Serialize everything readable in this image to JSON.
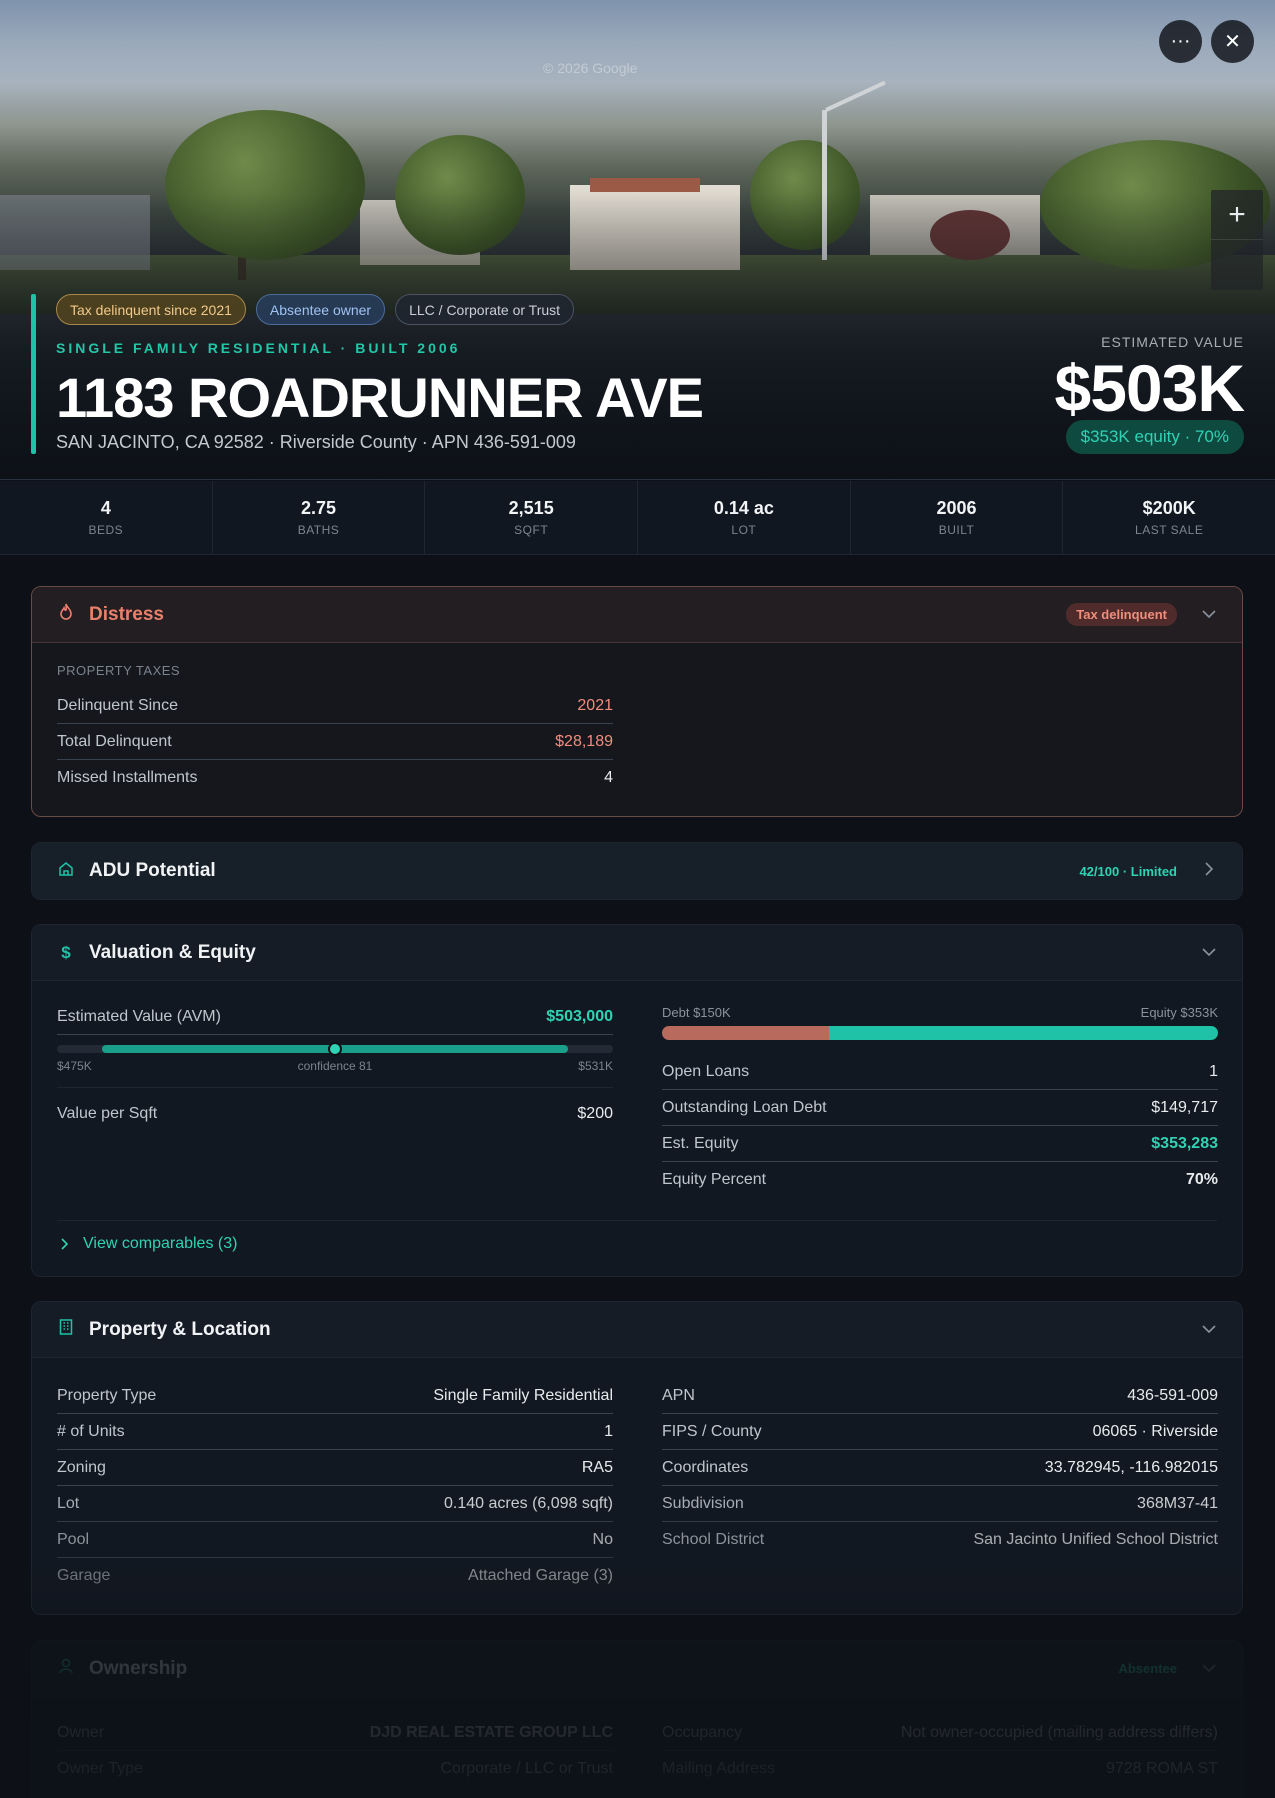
{
  "hero": {
    "watermark": "© 2026 Google",
    "badges": [
      "Tax delinquent since 2021",
      "Absentee owner",
      "LLC / Corporate or Trust"
    ],
    "subtitle": "SINGLE FAMILY RESIDENTIAL · BUILT 2006",
    "address": "1183 ROADRUNNER AVE",
    "location": "SAN JACINTO, CA 92582 · Riverside County · APN 436-591-009",
    "estimated_label": "ESTIMATED VALUE",
    "estimated_value": "$503K",
    "equity_pill": "$353K equity · 70%",
    "zoom_in": "+",
    "more_icon": "···",
    "close_icon": "✕"
  },
  "stats": [
    {
      "value": "4",
      "label": "BEDS"
    },
    {
      "value": "2.75",
      "label": "BATHS"
    },
    {
      "value": "2,515",
      "label": "SQFT"
    },
    {
      "value": "0.14 ac",
      "label": "LOT"
    },
    {
      "value": "2006",
      "label": "BUILT"
    },
    {
      "value": "$200K",
      "label": "LAST SALE"
    }
  ],
  "distress": {
    "title": "Distress",
    "badge": "Tax delinquent",
    "section": "PROPERTY TAXES",
    "rows": [
      {
        "k": "Delinquent Since",
        "v": "2021"
      },
      {
        "k": "Total Delinquent",
        "v": "$28,189"
      },
      {
        "k": "Missed Installments",
        "v": "4"
      }
    ]
  },
  "adu": {
    "title": "ADU Potential",
    "badge": "42/100 · Limited"
  },
  "valuation": {
    "title": "Valuation & Equity",
    "avm_label": "Estimated Value (AVM)",
    "avm_value": "$503,000",
    "avm_low": "$475K",
    "avm_confidence": "confidence 81",
    "avm_high": "$531K",
    "ppsf_label": "Value per Sqft",
    "ppsf_value": "$200",
    "debt_label": "Debt $150K",
    "equity_label": "Equity $353K",
    "debt_fraction": 0.3,
    "rows": [
      {
        "k": "Open Loans",
        "v": "1"
      },
      {
        "k": "Outstanding Loan Debt",
        "v": "$149,717"
      },
      {
        "k": "Est. Equity",
        "v": "$353,283"
      },
      {
        "k": "Equity Percent",
        "v": "70%"
      }
    ],
    "comparables": "View comparables (3)"
  },
  "property": {
    "title": "Property & Location",
    "left": [
      {
        "k": "Property Type",
        "v": "Single Family Residential"
      },
      {
        "k": "# of Units",
        "v": "1"
      },
      {
        "k": "Zoning",
        "v": "RA5"
      },
      {
        "k": "Lot",
        "v": "0.140 acres (6,098 sqft)"
      },
      {
        "k": "Pool",
        "v": "No"
      },
      {
        "k": "Garage",
        "v": "Attached Garage (3)"
      }
    ],
    "right": [
      {
        "k": "APN",
        "v": "436-591-009"
      },
      {
        "k": "FIPS / County",
        "v": "06065 · Riverside"
      },
      {
        "k": "Coordinates",
        "v": "33.782945, -116.982015"
      },
      {
        "k": "Subdivision",
        "v": "368M37-41"
      },
      {
        "k": "School District",
        "v": "San Jacinto Unified School District"
      }
    ]
  },
  "ownership": {
    "title": "Ownership",
    "badge": "Absentee",
    "left": [
      {
        "k": "Owner",
        "v": "DJD REAL ESTATE GROUP LLC"
      },
      {
        "k": "Owner Type",
        "v": "Corporate / LLC or Trust"
      }
    ],
    "right": [
      {
        "k": "Occupancy",
        "v": "Not owner-occupied (mailing address differs)"
      },
      {
        "k": "Mailing Address",
        "v": "9728 ROMA ST"
      }
    ]
  }
}
